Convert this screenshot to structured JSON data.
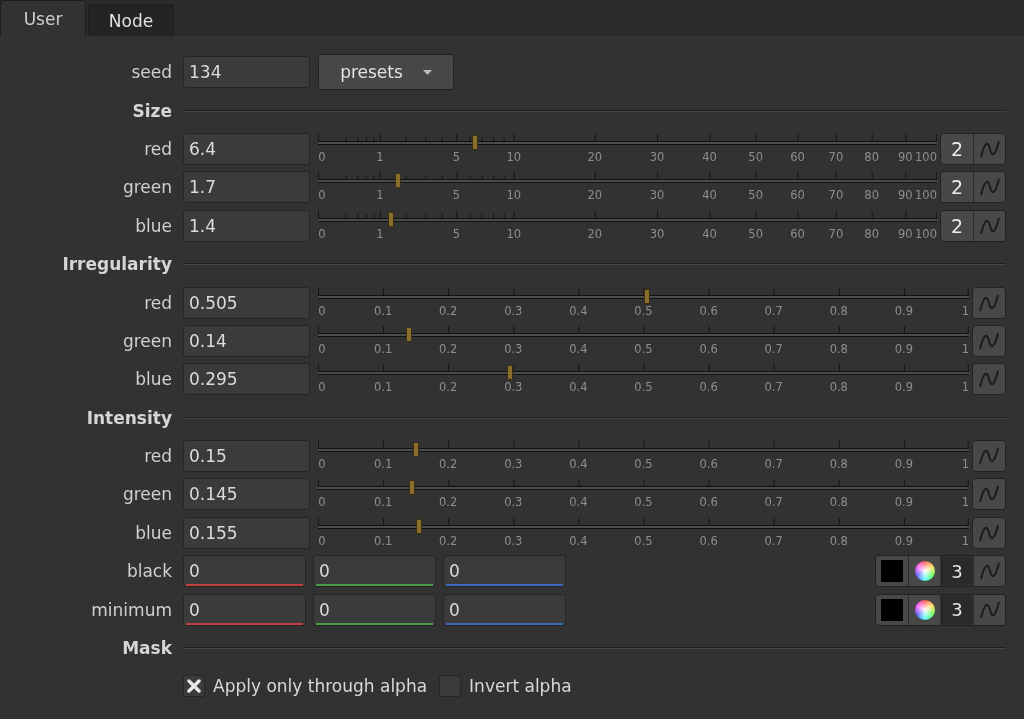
{
  "tabs": [
    {
      "label": "User",
      "selected": true
    },
    {
      "label": "Node",
      "selected": false
    }
  ],
  "seed": {
    "label": "seed",
    "value": "134"
  },
  "presets": {
    "label": "presets"
  },
  "sections": [
    {
      "title": "Size",
      "rows": [
        {
          "kind": "rootslider",
          "label": "red",
          "value": "6.4",
          "level": 0.253,
          "ticks": [
            "0",
            "1",
            "5",
            "10",
            "20",
            "30",
            "40",
            "50",
            "60",
            "70",
            "80",
            "90",
            "100"
          ],
          "channels": "2"
        },
        {
          "kind": "rootslider",
          "label": "green",
          "value": "1.7",
          "level": 0.13,
          "ticks": [
            "0",
            "1",
            "5",
            "10",
            "20",
            "30",
            "40",
            "50",
            "60",
            "70",
            "80",
            "90",
            "100"
          ],
          "channels": "2"
        },
        {
          "kind": "rootslider",
          "label": "blue",
          "value": "1.4",
          "level": 0.118,
          "ticks": [
            "0",
            "1",
            "5",
            "10",
            "20",
            "30",
            "40",
            "50",
            "60",
            "70",
            "80",
            "90",
            "100"
          ],
          "channels": "2"
        }
      ]
    },
    {
      "title": "Irregularity",
      "rows": [
        {
          "kind": "slider",
          "label": "red",
          "value": "0.505",
          "level": 0.505,
          "ticks": [
            "0",
            "0.1",
            "0.2",
            "0.3",
            "0.4",
            "0.5",
            "0.6",
            "0.7",
            "0.8",
            "0.9",
            "1"
          ]
        },
        {
          "kind": "slider",
          "label": "green",
          "value": "0.14",
          "level": 0.14,
          "ticks": [
            "0",
            "0.1",
            "0.2",
            "0.3",
            "0.4",
            "0.5",
            "0.6",
            "0.7",
            "0.8",
            "0.9",
            "1"
          ]
        },
        {
          "kind": "slider",
          "label": "blue",
          "value": "0.295",
          "level": 0.295,
          "ticks": [
            "0",
            "0.1",
            "0.2",
            "0.3",
            "0.4",
            "0.5",
            "0.6",
            "0.7",
            "0.8",
            "0.9",
            "1"
          ]
        }
      ]
    },
    {
      "title": "Intensity",
      "rows": [
        {
          "kind": "slider",
          "label": "red",
          "value": "0.15",
          "level": 0.15,
          "ticks": [
            "0",
            "0.1",
            "0.2",
            "0.3",
            "0.4",
            "0.5",
            "0.6",
            "0.7",
            "0.8",
            "0.9",
            "1"
          ]
        },
        {
          "kind": "slider",
          "label": "green",
          "value": "0.145",
          "level": 0.145,
          "ticks": [
            "0",
            "0.1",
            "0.2",
            "0.3",
            "0.4",
            "0.5",
            "0.6",
            "0.7",
            "0.8",
            "0.9",
            "1"
          ]
        },
        {
          "kind": "slider",
          "label": "blue",
          "value": "0.155",
          "level": 0.155,
          "ticks": [
            "0",
            "0.1",
            "0.2",
            "0.3",
            "0.4",
            "0.5",
            "0.6",
            "0.7",
            "0.8",
            "0.9",
            "1"
          ]
        },
        {
          "kind": "color",
          "label": "black",
          "values": [
            {
              "value": "0",
              "color": "#c04040"
            },
            {
              "value": "0",
              "color": "#4a9a4a"
            },
            {
              "value": "0",
              "color": "#3a68b8"
            }
          ],
          "channels": "3"
        },
        {
          "kind": "color",
          "label": "minimum",
          "values": [
            {
              "value": "0",
              "color": "#c04040"
            },
            {
              "value": "0",
              "color": "#4a9a4a"
            },
            {
              "value": "0",
              "color": "#3a68b8"
            }
          ],
          "channels": "3"
        }
      ]
    },
    {
      "title": "Mask",
      "rows": [
        {
          "kind": "checks",
          "items": [
            {
              "label": "Apply only through alpha",
              "checked": true
            },
            {
              "label": "Invert alpha",
              "checked": false
            }
          ]
        }
      ]
    }
  ]
}
